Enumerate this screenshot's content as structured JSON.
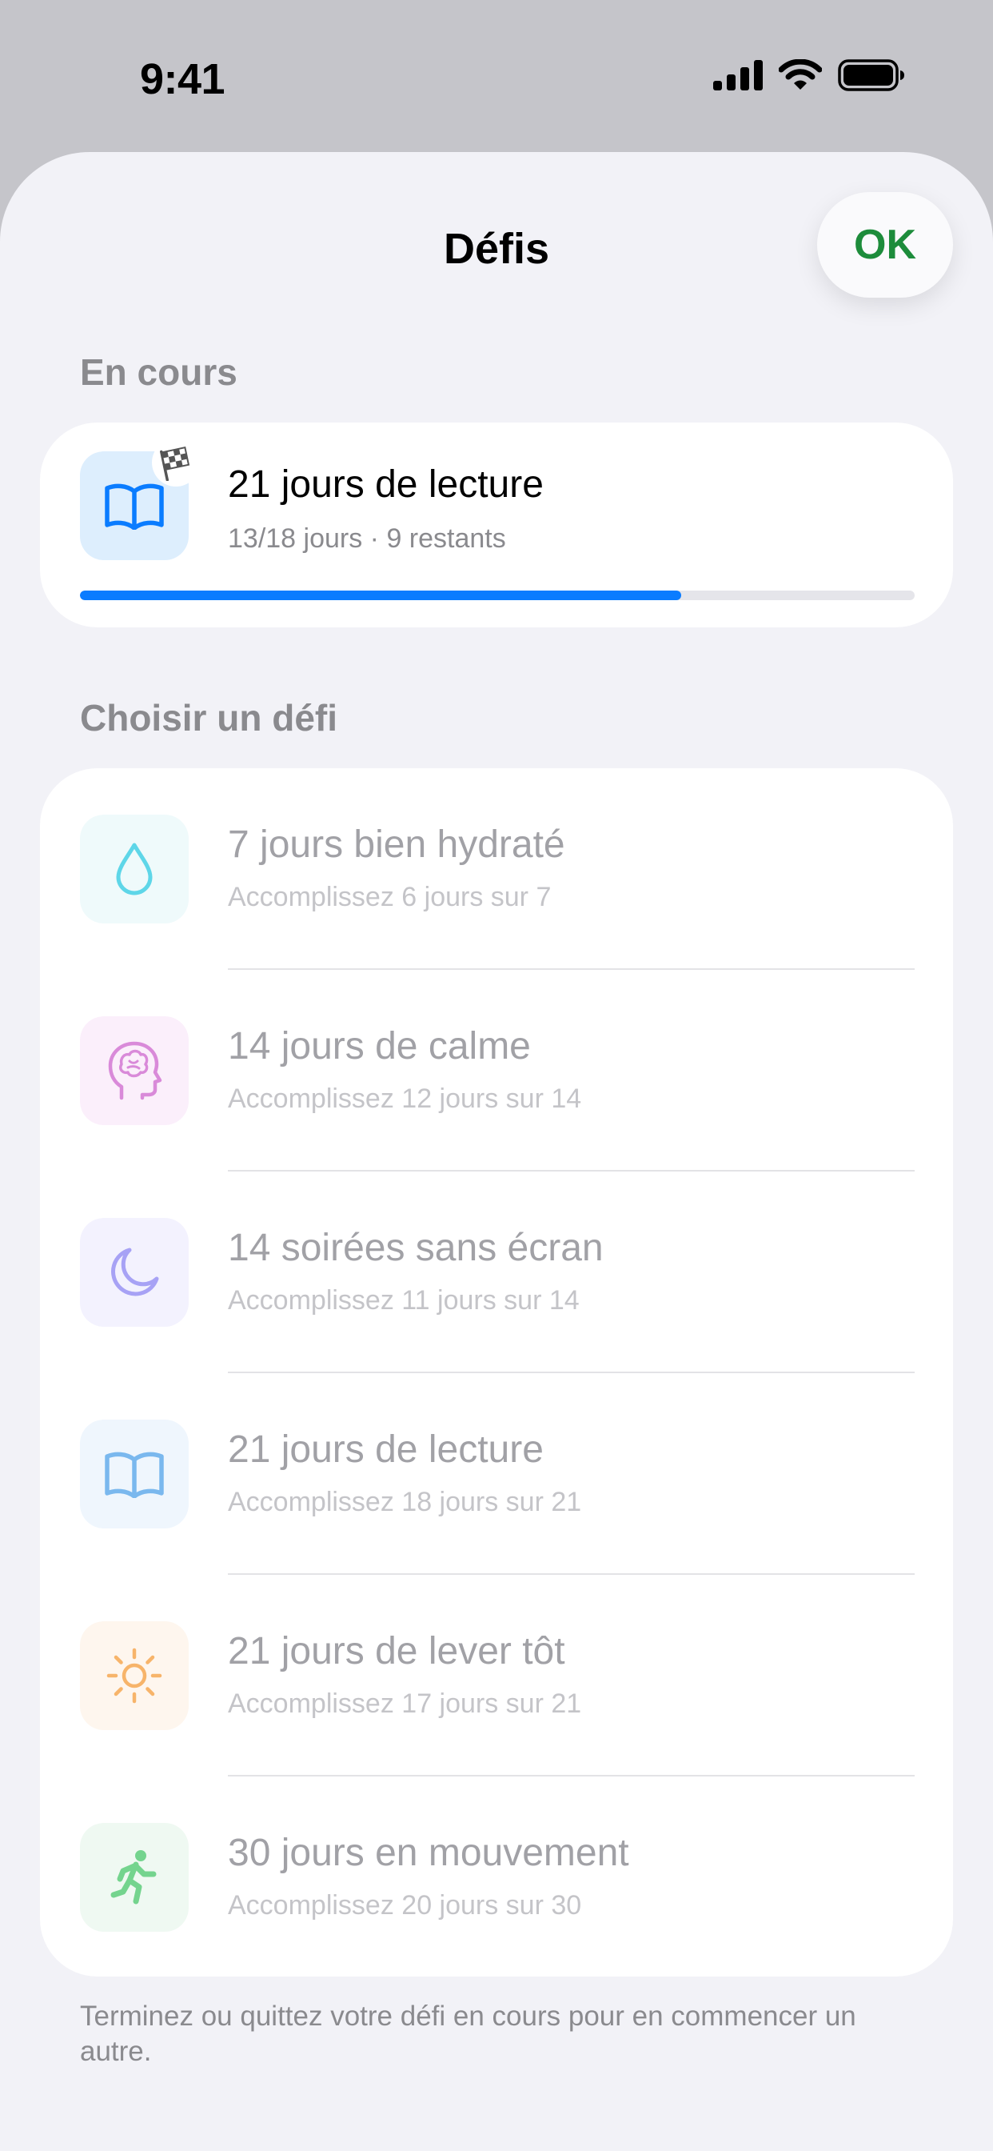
{
  "status_bar": {
    "time": "9:41"
  },
  "sheet": {
    "title": "Défis",
    "ok_label": "OK",
    "ok_color": "#1d8c3b"
  },
  "in_progress": {
    "header": "En cours",
    "title": "21 jours de lecture",
    "subtitle": "13/18 jours · 9 restants",
    "progress": 0.72,
    "icon": "book-icon",
    "badge_icon": "checkered-flag-icon",
    "accent": "#0a7cff"
  },
  "choose": {
    "header": "Choisir un défi",
    "items": [
      {
        "title": "7 jours bien hydraté",
        "subtitle": "Accomplissez 6 jours sur 7",
        "icon": "water-drop-icon",
        "color": "#5ed6e8"
      },
      {
        "title": "14 jours de calme",
        "subtitle": "Accomplissez 12 jours sur 14",
        "icon": "brain-head-icon",
        "color": "#d98ad9"
      },
      {
        "title": "14 soirées sans écran",
        "subtitle": "Accomplissez 11 jours sur 14",
        "icon": "moon-icon",
        "color": "#a7a2f5"
      },
      {
        "title": "21 jours de lecture",
        "subtitle": "Accomplissez 18 jours sur 21",
        "icon": "book-icon",
        "color": "#7ab8ee"
      },
      {
        "title": "21 jours de lever tôt",
        "subtitle": "Accomplissez 17 jours sur 21",
        "icon": "sun-icon",
        "color": "#f7b46a"
      },
      {
        "title": "30 jours en mouvement",
        "subtitle": "Accomplissez 20 jours sur 30",
        "icon": "running-figure-icon",
        "color": "#74d48e"
      }
    ]
  },
  "footer": "Terminez ou quittez votre défi en cours pour en commencer un autre."
}
